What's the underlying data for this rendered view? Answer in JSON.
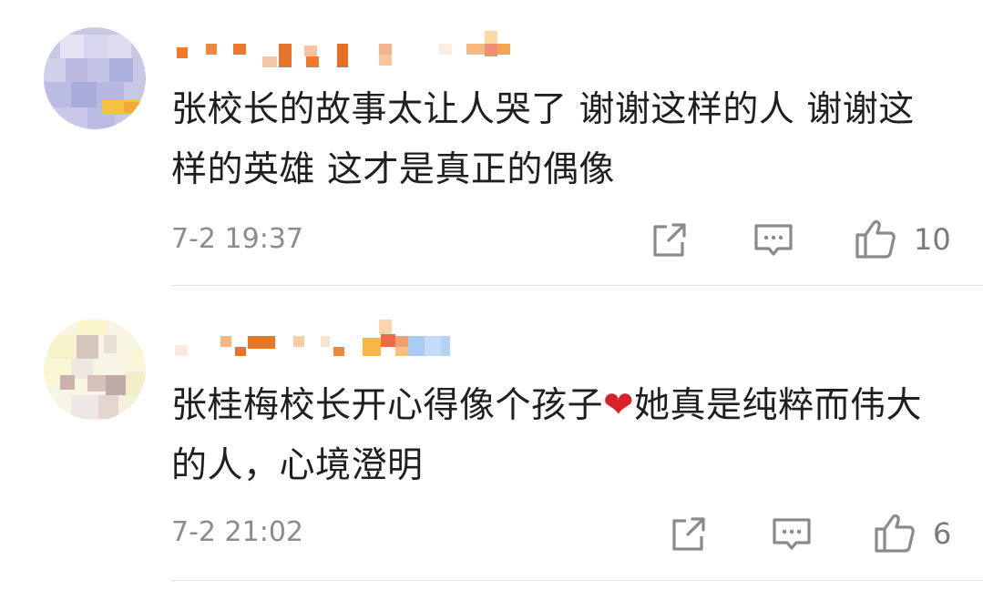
{
  "comments": [
    {
      "text": "张校长的故事太让人哭了 谢谢这样的人 谢谢这样的英雄 这才是真正的偶像",
      "time": "7-2 19:37",
      "like_count": "10"
    },
    {
      "text_a": "张桂梅校长开心得像个孩子",
      "text_b": "她真是纯粹而伟大的人，心境澄明",
      "time": "7-2 21:02",
      "like_count": "6"
    }
  ],
  "icons": {
    "share": "share-icon",
    "comment": "comment-icon",
    "like": "thumbs-up-icon",
    "heart": "red-heart-emoji"
  },
  "colors": {
    "text": "#1f1f1f",
    "meta": "#8c8c8c",
    "icon": "#8a8a8a",
    "heart": "#d8232a"
  }
}
